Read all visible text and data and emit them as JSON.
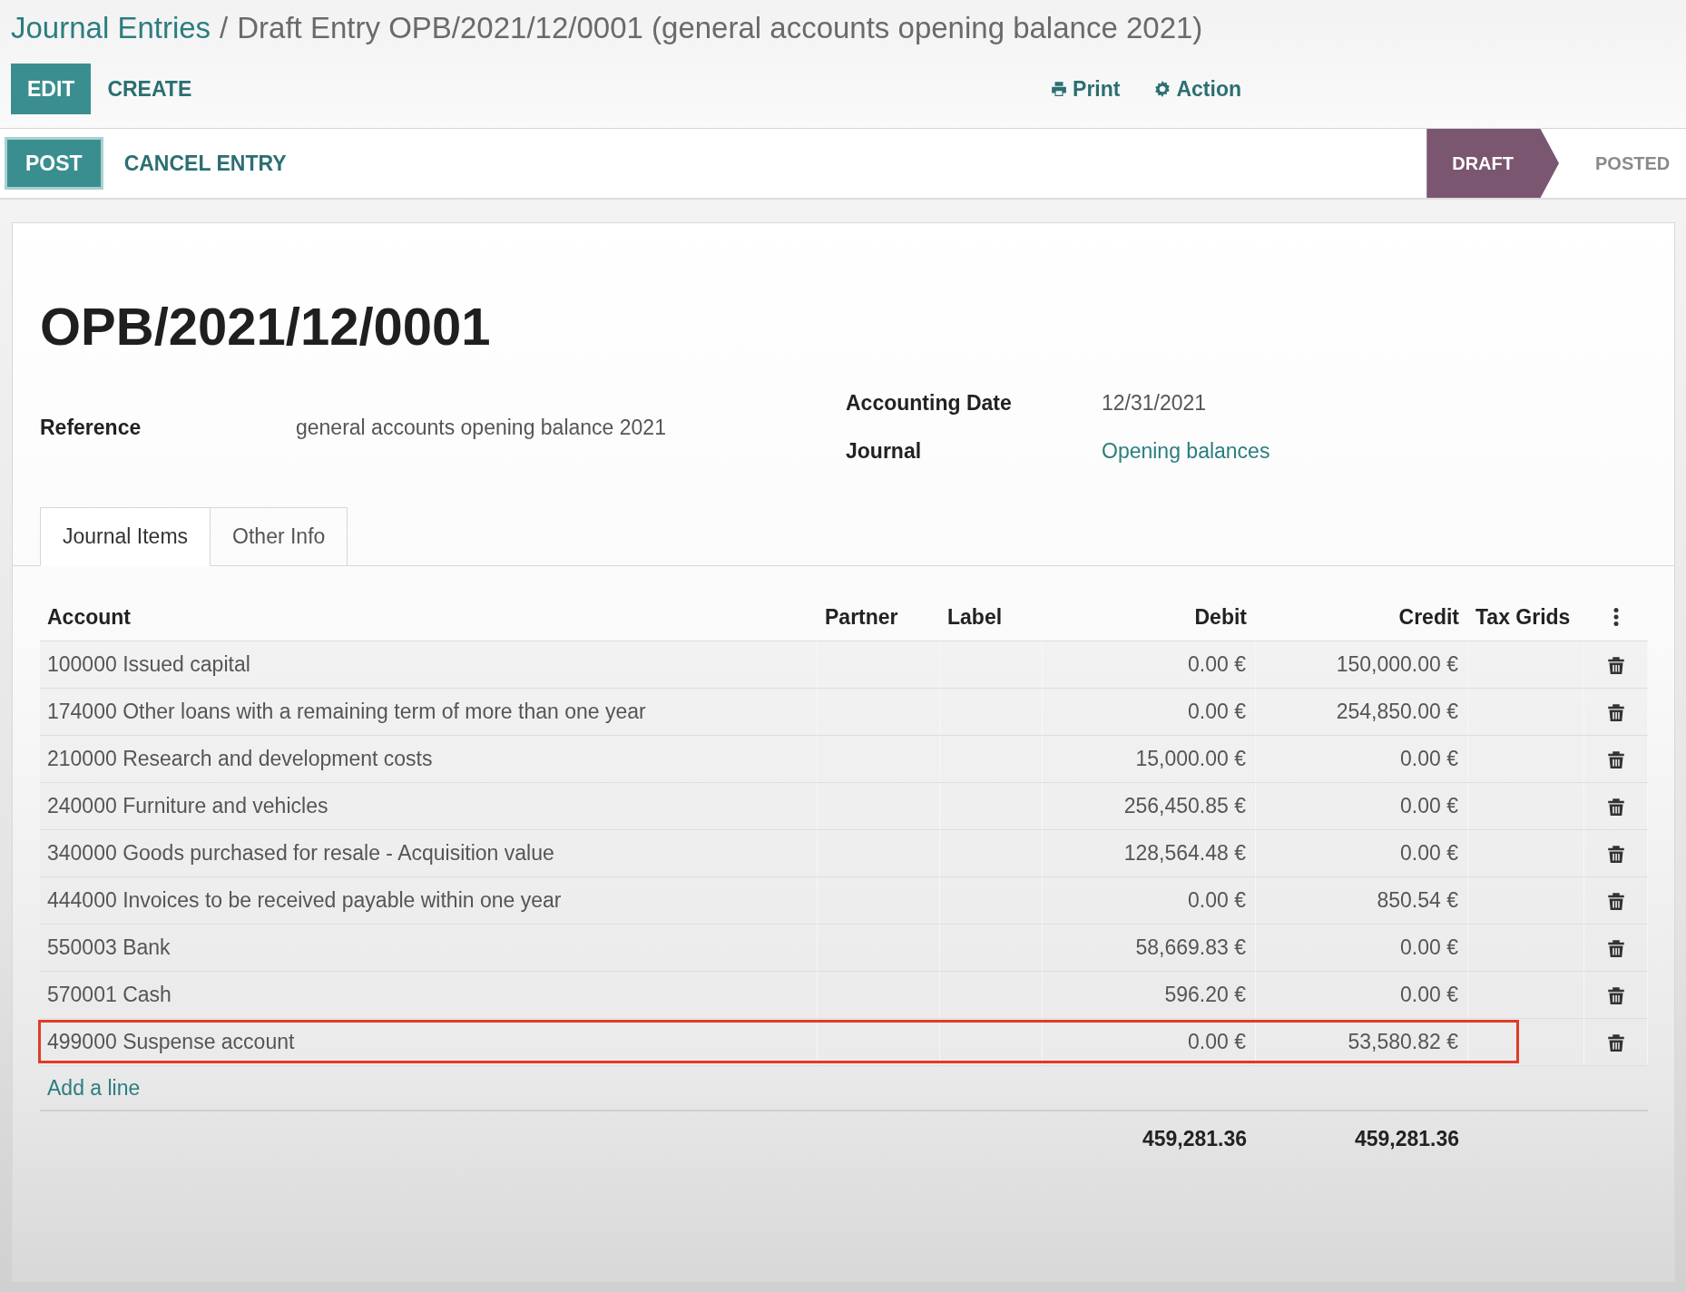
{
  "breadcrumb": {
    "parent": "Journal Entries",
    "separator": "/",
    "current": "Draft Entry OPB/2021/12/0001 (general accounts opening balance 2021)"
  },
  "main_buttons": [
    {
      "label": "EDIT",
      "kind": "primary"
    },
    {
      "label": "CREATE",
      "kind": "link"
    }
  ],
  "toolbar": [
    {
      "label": "Print"
    },
    {
      "label": "Action"
    }
  ],
  "header_buttons": [
    {
      "label": "POST",
      "kind": "primary"
    },
    {
      "label": "CANCEL ENTRY",
      "kind": "link"
    }
  ],
  "statusbar": [
    {
      "label": "DRAFT",
      "selected": true
    },
    {
      "label": "POSTED",
      "selected": false
    }
  ],
  "record": {
    "title": "OPB/2021/12/0001",
    "fields_left": [
      {
        "label": "Reference",
        "value": "general accounts opening balance 2021",
        "kind": "text"
      }
    ],
    "fields_right": [
      {
        "label": "Accounting Date",
        "value": "12/31/2021",
        "kind": "text"
      },
      {
        "label": "Journal",
        "value": "Opening balances",
        "kind": "link"
      }
    ]
  },
  "tabs": [
    {
      "label": "Journal Items",
      "selected": true
    },
    {
      "label": "Other Info",
      "selected": false
    }
  ],
  "table": {
    "columns": [
      "Account",
      "Partner",
      "Label",
      "Debit",
      "Credit",
      "Tax Grids"
    ],
    "rows": [
      {
        "account": "100000 Issued capital",
        "debit": "0.00 €",
        "credit": "150,000.00 €",
        "highlighted": false
      },
      {
        "account": "174000 Other loans with a remaining term of more than one year",
        "debit": "0.00 €",
        "credit": "254,850.00 €",
        "highlighted": false
      },
      {
        "account": "210000 Research and development costs",
        "debit": "15,000.00 €",
        "credit": "0.00 €",
        "highlighted": false
      },
      {
        "account": "240000 Furniture and vehicles",
        "debit": "256,450.85 €",
        "credit": "0.00 €",
        "highlighted": false
      },
      {
        "account": "340000 Goods purchased for resale - Acquisition value",
        "debit": "128,564.48 €",
        "credit": "0.00 €",
        "highlighted": false
      },
      {
        "account": "444000 Invoices to be received payable within one year",
        "debit": "0.00 €",
        "credit": "850.54 €",
        "highlighted": false
      },
      {
        "account": "550003 Bank",
        "debit": "58,669.83 €",
        "credit": "0.00 €",
        "highlighted": false
      },
      {
        "account": "570001 Cash",
        "debit": "596.20 €",
        "credit": "0.00 €",
        "highlighted": false
      },
      {
        "account": "499000 Suspense account",
        "debit": "0.00 €",
        "credit": "53,580.82 €",
        "highlighted": true
      }
    ],
    "add_line": "Add a line",
    "totals": {
      "debit": "459,281.36",
      "credit": "459,281.36"
    }
  }
}
